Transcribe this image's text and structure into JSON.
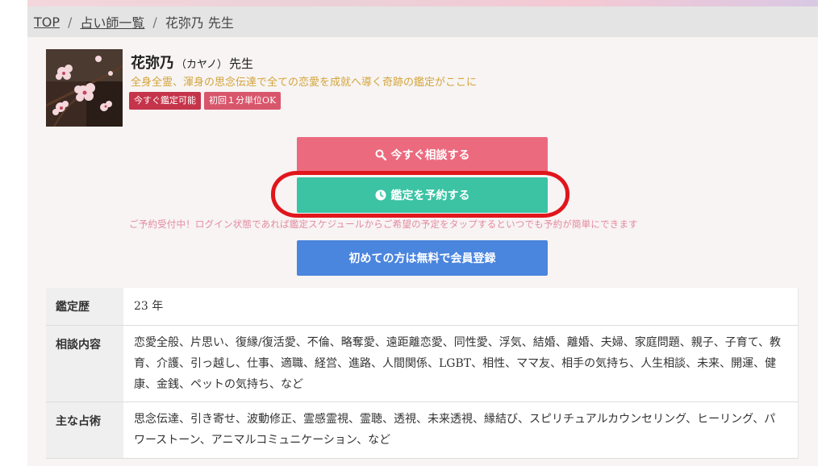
{
  "breadcrumb": {
    "items": [
      "TOP",
      "占い師一覧"
    ],
    "current": "花弥乃 先生",
    "separator": "/"
  },
  "profile": {
    "name": "花弥乃",
    "kana": "（カヤノ）",
    "title": "先生",
    "catchphrase": "全身全霊、渾身の思念伝達で全ての恋愛を成就へ導く奇跡の鑑定がここに",
    "badges": [
      "今すぐ鑑定可能",
      "初回１分単位OK"
    ]
  },
  "actions": {
    "consult_label": "今すぐ相談する",
    "reserve_label": "鑑定を予約する",
    "register_label": "初めての方は無料で会員登録",
    "reserve_notice": "ご予約受付中！ログイン状態であれば鑑定スケジュールからご希望の予定をタップするといつでも予約が簡単にできます"
  },
  "details": [
    {
      "label": "鑑定歴",
      "value": "23 年"
    },
    {
      "label": "相談内容",
      "value": "恋愛全般、片思い、復縁/復活愛、不倫、略奪愛、遠距離恋愛、同性愛、浮気、結婚、離婚、夫婦、家庭問題、親子、子育て、教育、介護、引っ越し、仕事、適職、経営、進路、人間関係、LGBT、相性、ママ友、相手の気持ち、人生相談、未来、開運、健康、金銭、ペットの気持ち、など"
    },
    {
      "label": "主な占術",
      "value": "思念伝達、引き寄せ、波動修正、霊感霊視、霊聴、透視、未来透視、縁結び、スピリチュアルカウンセリング、ヒーリング、パワーストーン、アニマルコミュニケーション、など"
    }
  ],
  "colors": {
    "consult": "#ec6a7e",
    "reserve": "#3bc3a4",
    "register": "#4a85de",
    "highlight_oval": "#e0161c",
    "badge": "#c5344a",
    "catch_text": "#d4a43a"
  },
  "icons": {
    "consult": "search-icon",
    "reserve": "clock-icon"
  }
}
